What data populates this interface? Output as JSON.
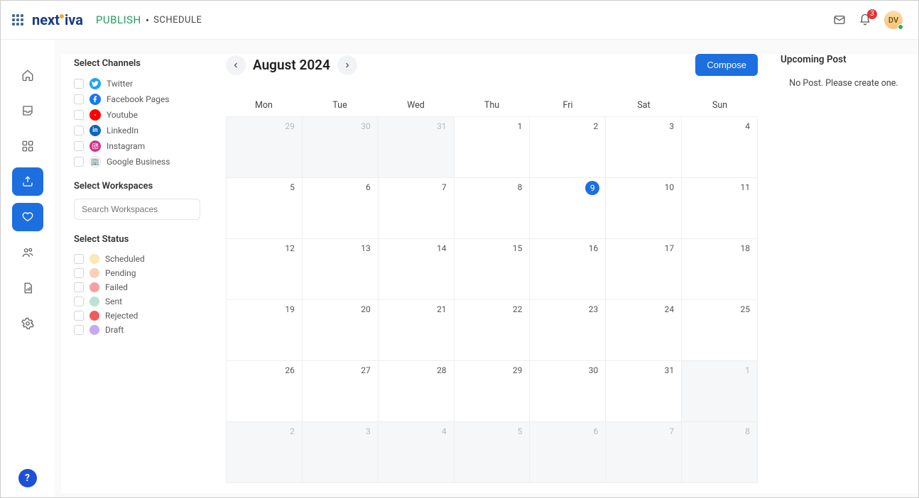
{
  "header": {
    "brand": "nextiva",
    "section": "PUBLISH",
    "breadcrumb": "SCHEDULE",
    "notification_count": "3",
    "avatar_initials": "DV"
  },
  "filters": {
    "channels_title": "Select Channels",
    "channels": [
      {
        "label": "Twitter",
        "bg": "#1da1f2"
      },
      {
        "label": "Facebook Pages",
        "bg": "#1877f2"
      },
      {
        "label": "Youtube",
        "bg": "#ff0000"
      },
      {
        "label": "LinkedIn",
        "bg": "#0a66c2"
      },
      {
        "label": "Instagram",
        "bg": "#d63384"
      },
      {
        "label": "Google Business",
        "bg": "#ffffff"
      }
    ],
    "workspaces_title": "Select Workspaces",
    "workspace_search_placeholder": "Search Workspaces",
    "status_title": "Select Status",
    "statuses": [
      {
        "label": "Scheduled",
        "color": "#fbe8b6"
      },
      {
        "label": "Pending",
        "color": "#fbd0b6"
      },
      {
        "label": "Failed",
        "color": "#f3a1a1"
      },
      {
        "label": "Sent",
        "color": "#b9e2d7"
      },
      {
        "label": "Rejected",
        "color": "#f25b5b"
      },
      {
        "label": "Draft",
        "color": "#c7a8f2"
      }
    ]
  },
  "calendar": {
    "title": "August 2024",
    "compose_label": "Compose",
    "weekdays": [
      "Mon",
      "Tue",
      "Wed",
      "Thu",
      "Fri",
      "Sat",
      "Sun"
    ],
    "today": 9,
    "cells": [
      {
        "n": 29,
        "other": true
      },
      {
        "n": 30,
        "other": true
      },
      {
        "n": 31,
        "other": true
      },
      {
        "n": 1
      },
      {
        "n": 2
      },
      {
        "n": 3
      },
      {
        "n": 4
      },
      {
        "n": 5
      },
      {
        "n": 6
      },
      {
        "n": 7
      },
      {
        "n": 8
      },
      {
        "n": 9,
        "today": true
      },
      {
        "n": 10
      },
      {
        "n": 11
      },
      {
        "n": 12
      },
      {
        "n": 13
      },
      {
        "n": 14
      },
      {
        "n": 15
      },
      {
        "n": 16
      },
      {
        "n": 17
      },
      {
        "n": 18
      },
      {
        "n": 19
      },
      {
        "n": 20
      },
      {
        "n": 21
      },
      {
        "n": 22
      },
      {
        "n": 23
      },
      {
        "n": 24
      },
      {
        "n": 25
      },
      {
        "n": 26
      },
      {
        "n": 27
      },
      {
        "n": 28
      },
      {
        "n": 29
      },
      {
        "n": 30
      },
      {
        "n": 31
      },
      {
        "n": 1,
        "other": true
      },
      {
        "n": 2,
        "other": true
      },
      {
        "n": 3,
        "other": true
      },
      {
        "n": 4,
        "other": true
      },
      {
        "n": 5,
        "other": true
      },
      {
        "n": 6,
        "other": true
      },
      {
        "n": 7,
        "other": true
      },
      {
        "n": 8,
        "other": true
      }
    ]
  },
  "upcoming": {
    "title": "Upcoming Post",
    "empty_text": "No Post. Please create one."
  }
}
